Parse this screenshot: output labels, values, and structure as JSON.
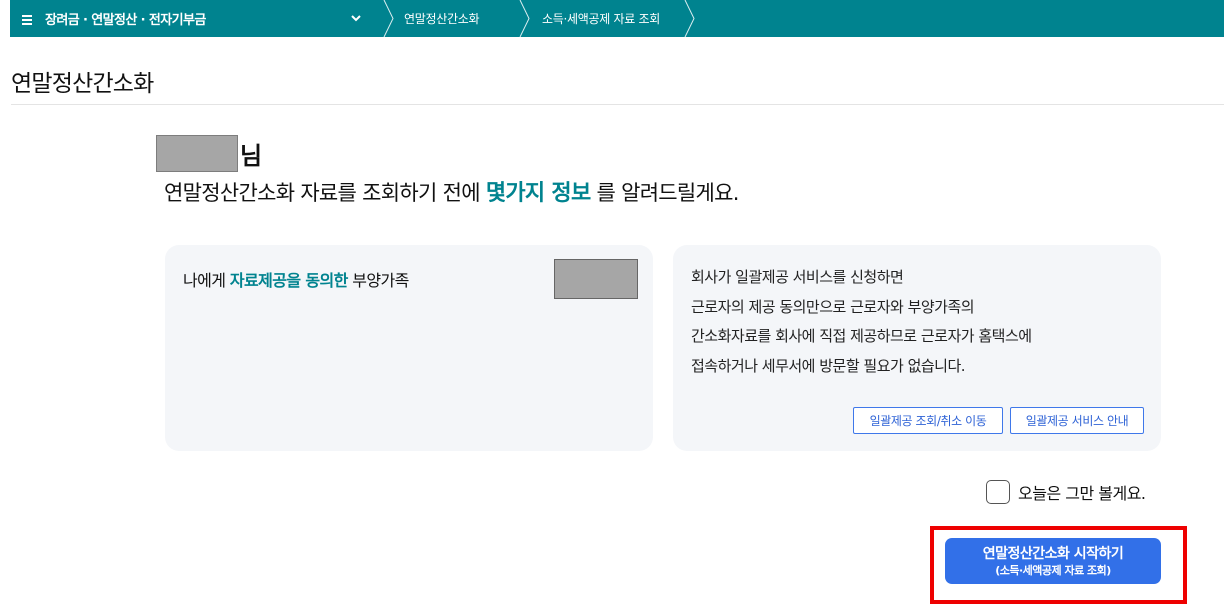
{
  "topbar": {
    "menu_label": "장려금 · 연말정산 · 전자기부금",
    "breadcrumbs": [
      "연말정산간소화",
      "소득·세액공제 자료 조회"
    ],
    "colors": {
      "background": "#00838f",
      "text": "#ffffff"
    }
  },
  "page": {
    "title": "연말정산간소화"
  },
  "greeting": {
    "honorific": "님",
    "intro_before": "연말정산간소화 자료를 조회하기 전에 ",
    "intro_accent": "몇가지 정보",
    "intro_after": " 를 알려드릴게요."
  },
  "dependents_card": {
    "prefix": "나에게 ",
    "accent": "자료제공을 동의한",
    "suffix": " 부양가족"
  },
  "info_card": {
    "lines": [
      "회사가 일괄제공 서비스를 신청하면",
      "근로자의 제공 동의만으로 근로자와 부양가족의",
      "간소화자료를 회사에 직접 제공하므로 근로자가 홈택스에",
      "접속하거나 세무서에 방문할 필요가 없습니다."
    ],
    "buttons": [
      "일괄제공 조회/취소 이동",
      "일괄제공 서비스 안내"
    ]
  },
  "skip_today": {
    "label": "오늘은 그만 볼게요.",
    "checked": false
  },
  "start_button": {
    "main": "연말정산간소화 시작하기",
    "sub": "(소득·세액공제 자료 조회)"
  },
  "colors": {
    "accent": "#00838f",
    "primary_button": "#3270e8",
    "link": "#2f63d6",
    "highlight_frame": "#ee0000",
    "mask": "#a6a6a6"
  }
}
